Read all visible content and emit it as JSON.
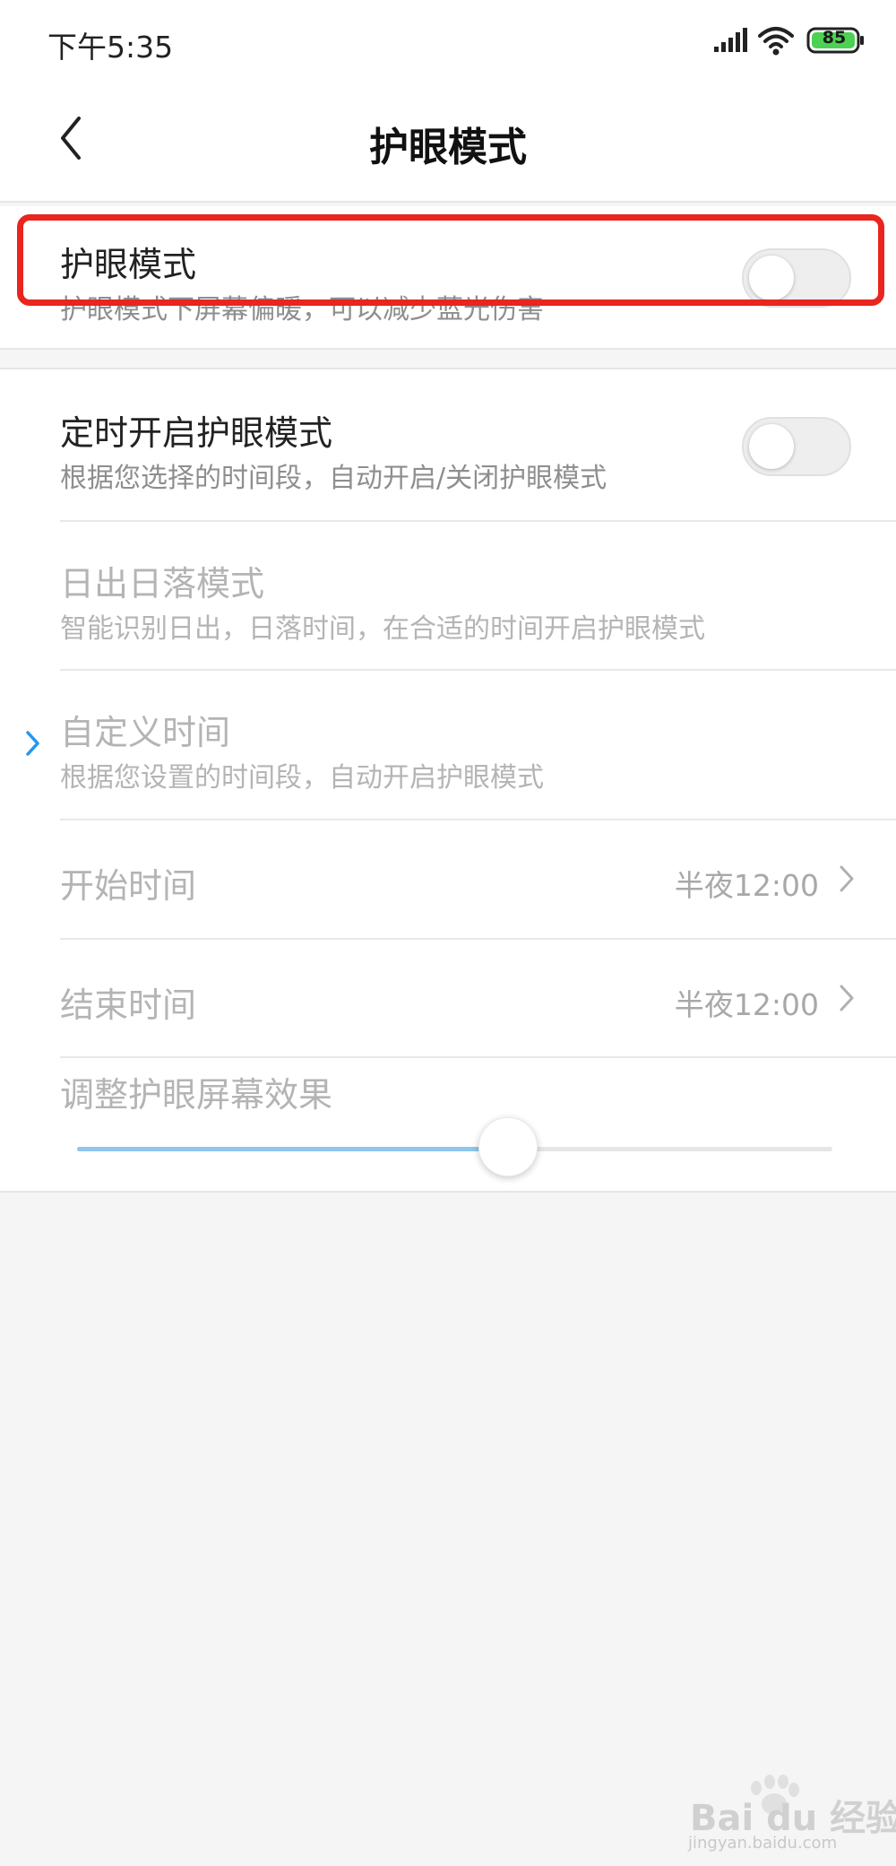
{
  "status_bar": {
    "time": "下午5:35",
    "battery": "85",
    "icons": [
      "signal-icon",
      "wifi-icon",
      "battery-icon"
    ]
  },
  "header": {
    "title": "护眼模式",
    "back_icon": "chevron-left-icon"
  },
  "eye_mode": {
    "title": "护眼模式",
    "subtitle": "护眼模式下屏幕偏暖，可以减少蓝光伤害",
    "enabled": false,
    "highlight_color": "#e8251e"
  },
  "schedule": {
    "title": "定时开启护眼模式",
    "subtitle": "根据您选择的时间段，自动开启/关闭护眼模式",
    "enabled": false,
    "options": [
      {
        "title": "日出日落模式",
        "subtitle": "智能识别日出，日落时间，在合适的时间开启护眼模式",
        "selected": false
      },
      {
        "title": "自定义时间",
        "subtitle": "根据您设置的时间段，自动开启护眼模式",
        "selected": true
      }
    ],
    "start_time": {
      "label": "开始时间",
      "value": "半夜12:00"
    },
    "end_time": {
      "label": "结束时间",
      "value": "半夜12:00"
    }
  },
  "effect": {
    "label": "调整护眼屏幕效果",
    "level": 0.57,
    "accent_color": "#8ec6ee"
  },
  "colors": {
    "selected_indicator": "#2196f3",
    "background": "#f5f5f5"
  },
  "watermark": {
    "main": "Bai du 经验",
    "sub": "jingyan.baidu.com"
  }
}
